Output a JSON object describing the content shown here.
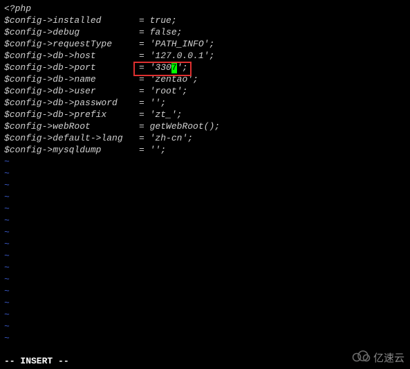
{
  "code": {
    "open_tag": "<?php",
    "lines": [
      {
        "key": "$config->installed",
        "pad": "       ",
        "eq": "= ",
        "val": "true;"
      },
      {
        "key": "$config->debug",
        "pad": "           ",
        "eq": "= ",
        "val": "false;"
      },
      {
        "key": "$config->requestType",
        "pad": "     ",
        "eq": "= ",
        "val": "'PATH_INFO';"
      },
      {
        "key": "$config->db->host",
        "pad": "        ",
        "eq": "= ",
        "val": "'127.0.0.1';"
      },
      {
        "key": "$config->db->port",
        "pad": "        ",
        "eq": "= ",
        "val": "'3307';",
        "cursor": true,
        "cursor_pre": "'330",
        "cursor_char": "7",
        "cursor_post": "';"
      },
      {
        "key": "$config->db->name",
        "pad": "        ",
        "eq": "= ",
        "val": "'zentao';"
      },
      {
        "key": "$config->db->user",
        "pad": "        ",
        "eq": "= ",
        "val": "'root';"
      },
      {
        "key": "$config->db->password",
        "pad": "    ",
        "eq": "= ",
        "val": "'';"
      },
      {
        "key": "$config->db->prefix",
        "pad": "      ",
        "eq": "= ",
        "val": "'zt_';"
      },
      {
        "key": "$config->webRoot",
        "pad": "         ",
        "eq": "= ",
        "val": "getWebRoot();"
      },
      {
        "key": "$config->default->lang",
        "pad": "   ",
        "eq": "= ",
        "val": "'zh-cn';"
      },
      {
        "key": "$config->mysqldump",
        "pad": "       ",
        "eq": "= ",
        "val": "'';"
      }
    ]
  },
  "tilde_count": 16,
  "tilde": "~",
  "status": "-- INSERT --",
  "watermark": {
    "text": "亿速云"
  },
  "colors": {
    "background": "#000000",
    "text": "#d0d0d0",
    "tilde": "#3b5bcc",
    "cursor": "#00ff00",
    "highlight_border": "#e03030"
  }
}
